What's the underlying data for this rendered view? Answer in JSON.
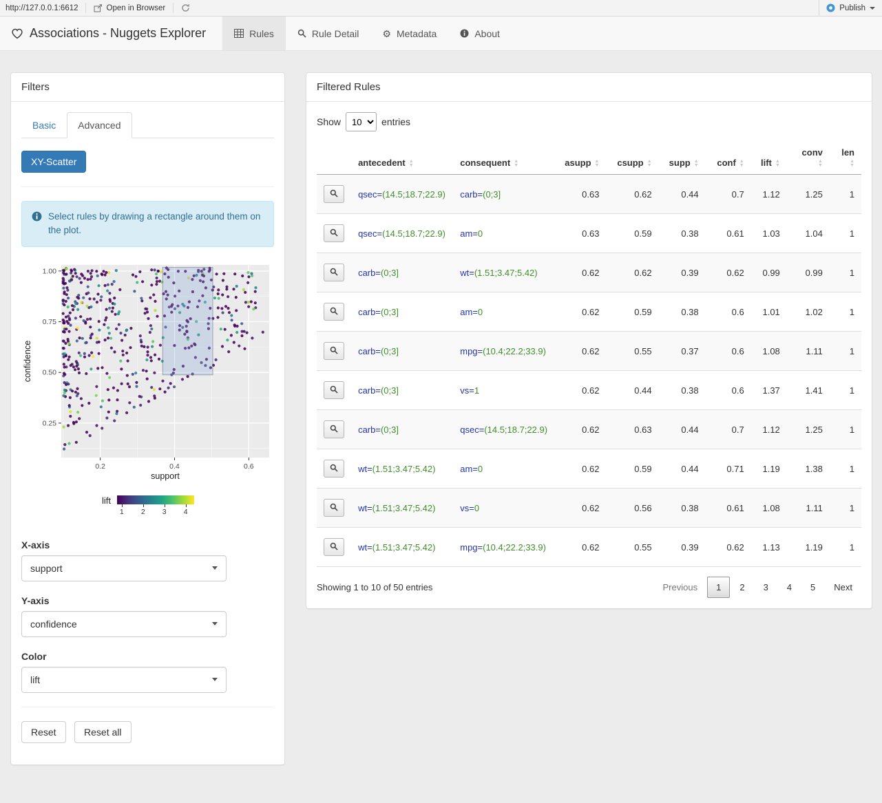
{
  "chrome": {
    "url": "http://127.0.0.1:6612",
    "open_in_browser_label": "Open in Browser",
    "publish_label": "Publish"
  },
  "navbar": {
    "title": "Associations - Nuggets Explorer",
    "tabs": [
      {
        "label": "Rules",
        "active": true
      },
      {
        "label": "Rule Detail",
        "active": false
      },
      {
        "label": "Metadata",
        "active": false
      },
      {
        "label": "About",
        "active": false
      }
    ]
  },
  "filters": {
    "title": "Filters",
    "tab_basic": "Basic",
    "tab_advanced": "Advanced",
    "scatter_button": "XY-Scatter",
    "alert_text": "Select rules by drawing a rectangle around them on the plot.",
    "x_axis": {
      "label": "X-axis",
      "value": "support"
    },
    "y_axis": {
      "label": "Y-axis",
      "value": "confidence"
    },
    "color": {
      "label": "Color",
      "value": "lift"
    },
    "reset_label": "Reset",
    "reset_all_label": "Reset all"
  },
  "rules_panel": {
    "title": "Filtered Rules",
    "show_label": "Show",
    "entries_label": "entries",
    "page_length": "10",
    "columns": [
      "antecedent",
      "consequent",
      "asupp",
      "csupp",
      "supp",
      "conf",
      "lift",
      "conv",
      "len"
    ],
    "rows": [
      {
        "antecedent": {
          "attr": "qsec=",
          "value": "(14.5;18.7;22.9)"
        },
        "consequent": {
          "attr": "carb=",
          "value": "(0;3]"
        },
        "asupp": "0.63",
        "csupp": "0.62",
        "supp": "0.44",
        "conf": "0.7",
        "lift": "1.12",
        "conv": "1.25",
        "len": "1"
      },
      {
        "antecedent": {
          "attr": "qsec=",
          "value": "(14.5;18.7;22.9)"
        },
        "consequent": {
          "attr": "am=",
          "value": "0"
        },
        "asupp": "0.63",
        "csupp": "0.59",
        "supp": "0.38",
        "conf": "0.61",
        "lift": "1.03",
        "conv": "1.04",
        "len": "1"
      },
      {
        "antecedent": {
          "attr": "carb=",
          "value": "(0;3]"
        },
        "consequent": {
          "attr": "wt=",
          "value": "(1.51;3.47;5.42)"
        },
        "asupp": "0.62",
        "csupp": "0.62",
        "supp": "0.39",
        "conf": "0.62",
        "lift": "0.99",
        "conv": "0.99",
        "len": "1"
      },
      {
        "antecedent": {
          "attr": "carb=",
          "value": "(0;3]"
        },
        "consequent": {
          "attr": "am=",
          "value": "0"
        },
        "asupp": "0.62",
        "csupp": "0.59",
        "supp": "0.38",
        "conf": "0.6",
        "lift": "1.01",
        "conv": "1.02",
        "len": "1"
      },
      {
        "antecedent": {
          "attr": "carb=",
          "value": "(0;3]"
        },
        "consequent": {
          "attr": "mpg=",
          "value": "(10.4;22.2;33.9)"
        },
        "asupp": "0.62",
        "csupp": "0.55",
        "supp": "0.37",
        "conf": "0.6",
        "lift": "1.08",
        "conv": "1.11",
        "len": "1"
      },
      {
        "antecedent": {
          "attr": "carb=",
          "value": "(0;3]"
        },
        "consequent": {
          "attr": "vs=",
          "value": "1"
        },
        "asupp": "0.62",
        "csupp": "0.44",
        "supp": "0.38",
        "conf": "0.6",
        "lift": "1.37",
        "conv": "1.41",
        "len": "1"
      },
      {
        "antecedent": {
          "attr": "carb=",
          "value": "(0;3]"
        },
        "consequent": {
          "attr": "qsec=",
          "value": "(14.5;18.7;22.9)"
        },
        "asupp": "0.62",
        "csupp": "0.63",
        "supp": "0.44",
        "conf": "0.7",
        "lift": "1.12",
        "conv": "1.25",
        "len": "1"
      },
      {
        "antecedent": {
          "attr": "wt=",
          "value": "(1.51;3.47;5.42)"
        },
        "consequent": {
          "attr": "am=",
          "value": "0"
        },
        "asupp": "0.62",
        "csupp": "0.59",
        "supp": "0.44",
        "conf": "0.71",
        "lift": "1.19",
        "conv": "1.38",
        "len": "1"
      },
      {
        "antecedent": {
          "attr": "wt=",
          "value": "(1.51;3.47;5.42)"
        },
        "consequent": {
          "attr": "vs=",
          "value": "0"
        },
        "asupp": "0.62",
        "csupp": "0.56",
        "supp": "0.38",
        "conf": "0.61",
        "lift": "1.08",
        "conv": "1.11",
        "len": "1"
      },
      {
        "antecedent": {
          "attr": "wt=",
          "value": "(1.51;3.47;5.42)"
        },
        "consequent": {
          "attr": "mpg=",
          "value": "(10.4;22.2;33.9)"
        },
        "asupp": "0.62",
        "csupp": "0.55",
        "supp": "0.39",
        "conf": "0.62",
        "lift": "1.13",
        "conv": "1.19",
        "len": "1"
      }
    ],
    "info": "Showing 1 to 10 of 50 entries",
    "pagination": {
      "previous": "Previous",
      "pages": [
        "1",
        "2",
        "3",
        "4",
        "5"
      ],
      "current": "1",
      "next": "Next"
    }
  },
  "chart_data": {
    "type": "scatter",
    "xlabel": "support",
    "ylabel": "confidence",
    "x_ticks": [
      0.2,
      0.4,
      0.6
    ],
    "x_minor": [
      0.1,
      0.3,
      0.5
    ],
    "y_ticks": [
      0.25,
      0.5,
      0.75,
      1.0
    ],
    "y_minor": [
      0.125,
      0.375,
      0.625,
      0.875
    ],
    "y_tick_labels": [
      "0.25",
      "0.50",
      "0.75",
      "1.00"
    ],
    "xlim": [
      0.095,
      0.655
    ],
    "ylim": [
      0.08,
      1.03
    ],
    "legend": {
      "label": "lift",
      "ticks": [
        1,
        2,
        3,
        4
      ],
      "domain": [
        0.78,
        4.4
      ],
      "palette": "viridis"
    },
    "selection_rect": {
      "x0": 0.368,
      "x1": 0.503,
      "y0": 0.488,
      "y1": 1.018
    },
    "points_approx": {
      "seed": 77,
      "n_cloud": 480,
      "streak_asupp": [
        0.91,
        0.8
      ],
      "x_range": [
        0.1,
        0.64
      ],
      "note": "~500 association rules; dense mass at low support with confidence>=support fan structure; point color = lift, mostly 0.8-1.5 (dark viridis) with scattered teal/green/yellow up to ~4.4"
    }
  },
  "colors": {
    "accent_blue": "#337ab7",
    "attribute_text": "#2433b0",
    "value_text": "#3f8f29",
    "alert_bg": "#d9edf7",
    "panel_border": "#dddddd",
    "plot_bg": "#ebebeb",
    "selection_fill": "rgba(130,160,215,0.28)",
    "active_tab_bg": "#e7e7e7"
  }
}
